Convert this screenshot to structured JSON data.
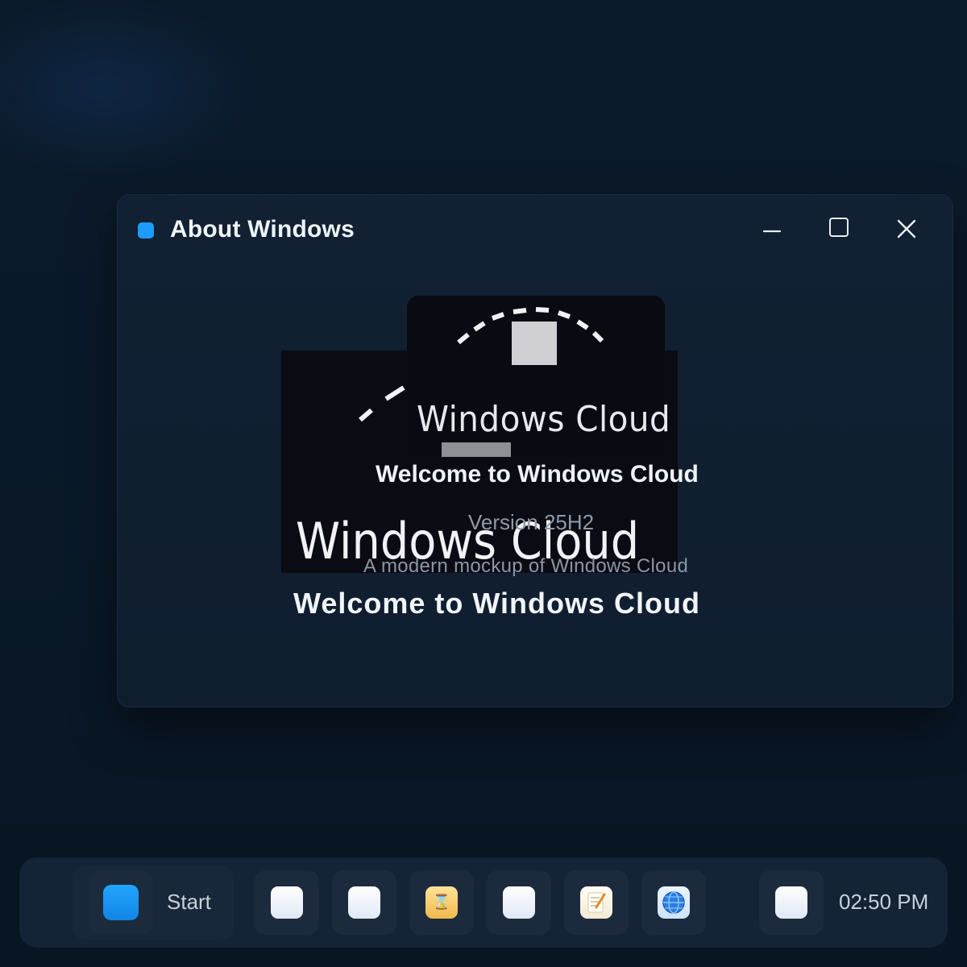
{
  "window": {
    "title": "About Windows",
    "controls": {
      "minimize_icon": "minimize-icon",
      "maximize_icon": "maximize-icon",
      "close_icon": "close-icon"
    }
  },
  "splash": {
    "logo_wordmark_small": "Windows Cloud",
    "logo_wordmark_large": "Windows Cloud",
    "welcome": "Welcome to Windows Cloud",
    "version": "Version 25H2",
    "tagline": "A modern mockup of Windows Cloud",
    "welcome_large": "Welcome to Windows Cloud"
  },
  "taskbar": {
    "start_label": "Start",
    "clock": "02:50 PM",
    "apps": [
      {
        "icon": "app-icon"
      },
      {
        "icon": "app-icon"
      },
      {
        "icon": "hourglass-icon",
        "glyph": "⌛"
      },
      {
        "icon": "app-icon"
      },
      {
        "icon": "notepad-icon"
      },
      {
        "icon": "globe-icon"
      },
      {
        "icon": "app-icon"
      }
    ]
  },
  "colors": {
    "accent": "#1e9bff",
    "window_bg": "#112032",
    "desktop_bg": "#0a1929",
    "taskbar_bg": "#162638"
  }
}
